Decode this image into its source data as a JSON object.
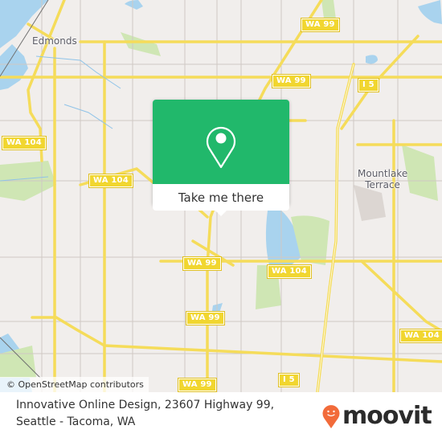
{
  "map": {
    "place_labels": [
      {
        "id": "edmonds",
        "text": "Edmonds"
      },
      {
        "id": "mountlake-terrace",
        "text": "Mountlake\nTerrace"
      }
    ],
    "road_shields": [
      {
        "id": "wa99-top",
        "text": "WA 99"
      },
      {
        "id": "wa99-upper",
        "text": "WA 99"
      },
      {
        "id": "i5-upper",
        "text": "I 5"
      },
      {
        "id": "wa104-left",
        "text": "WA 104"
      },
      {
        "id": "wa104-west",
        "text": "WA 104"
      },
      {
        "id": "wa99-mid",
        "text": "WA 99"
      },
      {
        "id": "wa104-mid",
        "text": "WA 104"
      },
      {
        "id": "wa99-lower",
        "text": "WA 99"
      },
      {
        "id": "wa104-right",
        "text": "WA 104"
      },
      {
        "id": "wa99-bottom",
        "text": "WA 99"
      },
      {
        "id": "i5-bottom",
        "text": "I 5"
      }
    ],
    "attribution": "© OpenStreetMap contributors",
    "colors": {
      "land": "#f1eeec",
      "water": "#a9d3ee",
      "park": "#cfe6b4",
      "road": "#f5dc5a",
      "minor_road": "#c9c2c0"
    }
  },
  "popup": {
    "icon": "location-pin-icon",
    "button_label": "Take me there",
    "accent": "#21b86b"
  },
  "footer": {
    "address": "Innovative Online Design, 23607 Highway 99, Seattle - Tacoma, WA",
    "brand": "moovit",
    "brand_icon": "moovit-pin-icon",
    "brand_accent": "#f26b3a"
  }
}
